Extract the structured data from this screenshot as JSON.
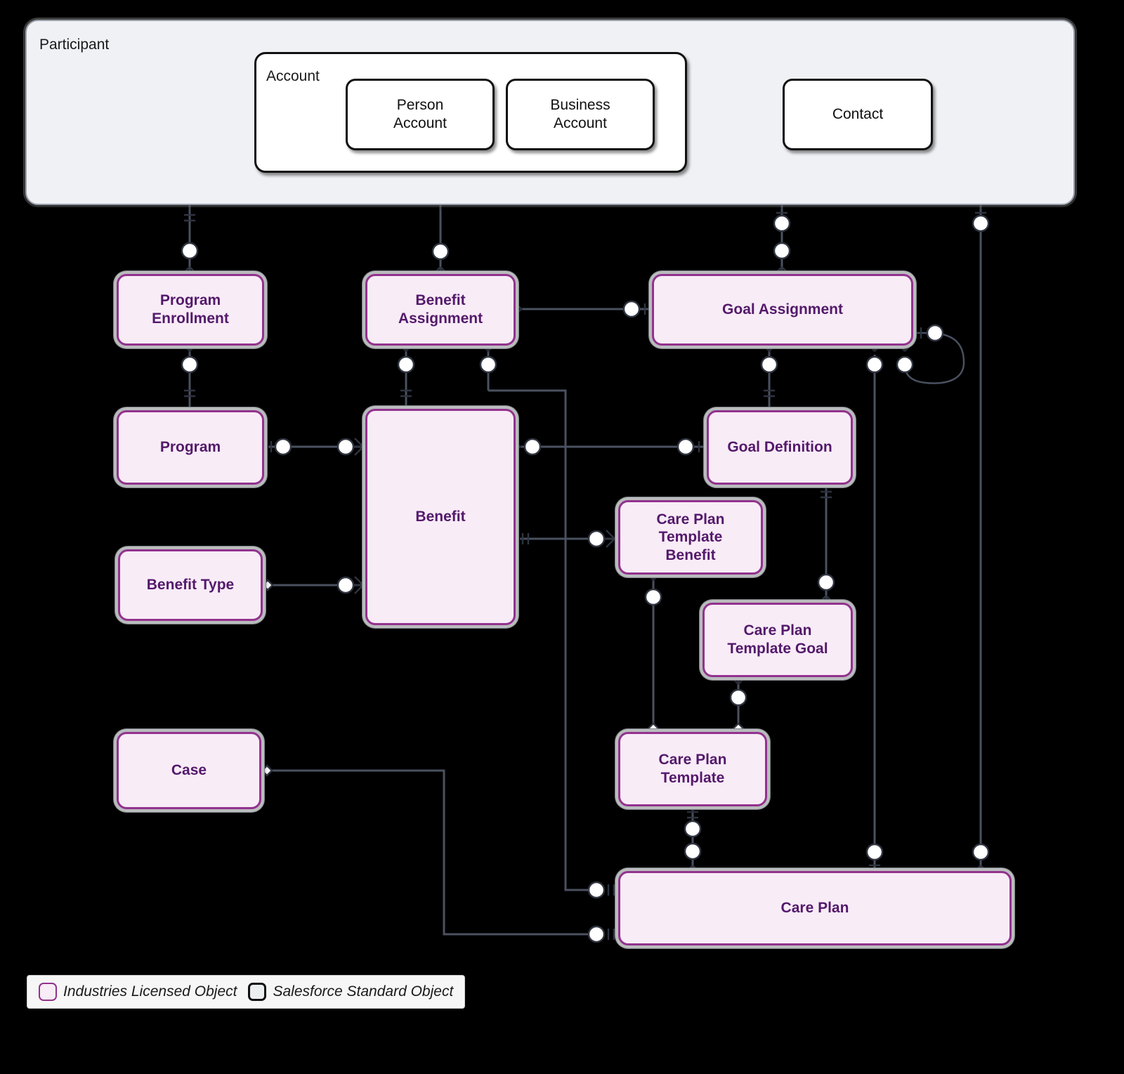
{
  "diagram": {
    "type": "entity-relationship-diagram",
    "background": "#000000",
    "colors": {
      "licensed_border": "#93328e",
      "licensed_fill": "#f8ecf7",
      "licensed_text": "#54196b",
      "standard_border": "#111111",
      "standard_fill": "#ffffff",
      "group_fill": "#f0f1f5",
      "connector": "#4a5160"
    }
  },
  "groups": [
    {
      "id": "participant",
      "label": "Participant",
      "kind": "container"
    },
    {
      "id": "account",
      "label": "Account",
      "kind": "standard"
    }
  ],
  "entities": [
    {
      "id": "person_account",
      "label": "Person\nAccount",
      "kind": "standard"
    },
    {
      "id": "business_account",
      "label": "Business\nAccount",
      "kind": "standard"
    },
    {
      "id": "contact",
      "label": "Contact",
      "kind": "standard"
    },
    {
      "id": "program_enrollment",
      "label": "Program\nEnrollment",
      "kind": "licensed"
    },
    {
      "id": "benefit_assignment",
      "label": "Benefit\nAssignment",
      "kind": "licensed"
    },
    {
      "id": "goal_assignment",
      "label": "Goal Assignment",
      "kind": "licensed"
    },
    {
      "id": "program",
      "label": "Program",
      "kind": "licensed"
    },
    {
      "id": "benefit",
      "label": "Benefit",
      "kind": "licensed"
    },
    {
      "id": "goal_definition",
      "label": "Goal Definition",
      "kind": "licensed"
    },
    {
      "id": "care_plan_template_benefit",
      "label": "Care Plan\nTemplate\nBenefit",
      "kind": "licensed"
    },
    {
      "id": "benefit_type",
      "label": "Benefit Type",
      "kind": "licensed"
    },
    {
      "id": "care_plan_template_goal",
      "label": "Care Plan\nTemplate Goal",
      "kind": "licensed"
    },
    {
      "id": "case",
      "label": "Case",
      "kind": "licensed"
    },
    {
      "id": "care_plan_template",
      "label": "Care Plan\nTemplate",
      "kind": "licensed"
    },
    {
      "id": "care_plan",
      "label": "Care Plan",
      "kind": "licensed"
    }
  ],
  "relationships": [
    {
      "from": "account",
      "to": "contact",
      "from_card": "aggregation",
      "to_card": "one-many"
    },
    {
      "from": "participant",
      "to": "program_enrollment",
      "from_card": "one",
      "to_card": "zero-many"
    },
    {
      "from": "account",
      "to": "benefit_assignment",
      "from_card": "one",
      "to_card": "zero-many"
    },
    {
      "from": "participant",
      "to": "goal_assignment",
      "from_card": "one",
      "to_card": "zero-many"
    },
    {
      "from": "participant",
      "to": "care_plan",
      "from_card": "one",
      "to_card": "zero-many"
    },
    {
      "from": "program_enrollment",
      "to": "program",
      "from_card": "zero-many",
      "to_card": "one"
    },
    {
      "from": "benefit_assignment",
      "to": "benefit",
      "from_card": "zero-many",
      "to_card": "one"
    },
    {
      "from": "benefit_assignment",
      "to": "goal_assignment",
      "from_card": "zero-many",
      "to_card": "one"
    },
    {
      "from": "benefit_assignment",
      "to": "care_plan",
      "from_card": "zero-many",
      "to_card": "one"
    },
    {
      "from": "program",
      "to": "benefit",
      "from_card": "one",
      "to_card": "zero-many"
    },
    {
      "from": "benefit_type",
      "to": "benefit",
      "from_card": "aggregation",
      "to_card": "zero-many"
    },
    {
      "from": "benefit",
      "to": "goal_definition",
      "from_card": "zero-many",
      "to_card": "one"
    },
    {
      "from": "benefit",
      "to": "care_plan_template_benefit",
      "from_card": "one",
      "to_card": "zero-many"
    },
    {
      "from": "goal_assignment",
      "to": "goal_definition",
      "from_card": "zero-many",
      "to_card": "one"
    },
    {
      "from": "goal_assignment",
      "to": "goal_assignment",
      "from_card": "zero-many",
      "to_card": "one",
      "self_loop": true
    },
    {
      "from": "goal_assignment",
      "to": "care_plan",
      "from_card": "zero-many",
      "to_card": "one"
    },
    {
      "from": "goal_definition",
      "to": "care_plan_template_goal",
      "from_card": "one",
      "to_card": "zero-many"
    },
    {
      "from": "care_plan_template_benefit",
      "to": "care_plan_template",
      "from_card": "zero-many",
      "to_card": "aggregation"
    },
    {
      "from": "care_plan_template_goal",
      "to": "care_plan_template",
      "from_card": "zero-many",
      "to_card": "aggregation"
    },
    {
      "from": "care_plan_template",
      "to": "care_plan",
      "from_card": "one",
      "to_card": "zero-many"
    },
    {
      "from": "case",
      "to": "care_plan",
      "from_card": "aggregation",
      "to_card": "zero-many"
    }
  ],
  "legend": {
    "items": [
      {
        "id": "licensed",
        "label": "Industries Licensed Object"
      },
      {
        "id": "standard",
        "label": "Salesforce Standard Object"
      }
    ]
  }
}
